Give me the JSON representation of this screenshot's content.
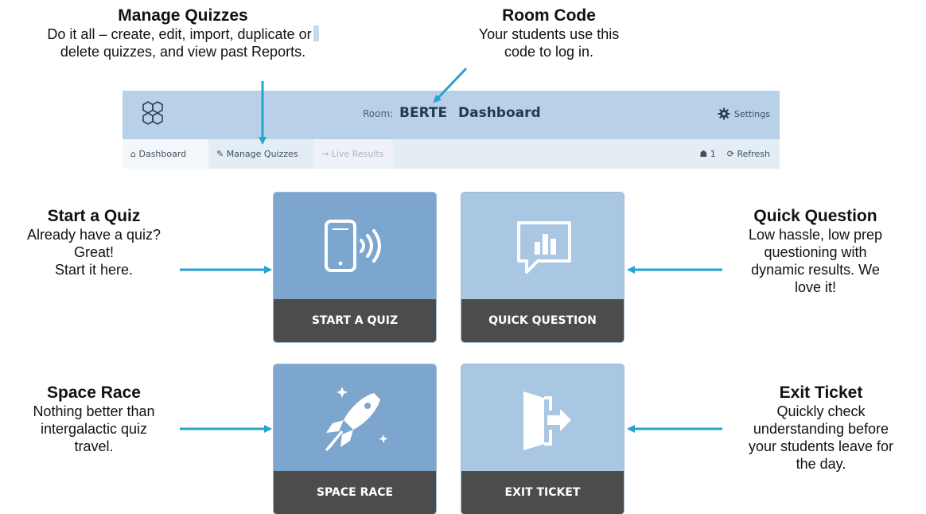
{
  "callouts": {
    "manage": {
      "title": "Manage Quizzes",
      "text": [
        "Do it all – create, edit, import, duplicate or",
        "delete quizzes, and view past Reports."
      ]
    },
    "room": {
      "title": "Room Code",
      "text": [
        "Your students use this",
        "code to log in."
      ]
    },
    "start": {
      "title": "Start a Quiz",
      "text": [
        "Already have a quiz?",
        "Great!",
        "Start it here."
      ]
    },
    "quick": {
      "title": "Quick Question",
      "text": [
        "Low hassle, low prep",
        "questioning with",
        "dynamic results. We",
        "love it!"
      ]
    },
    "space": {
      "title": "Space Race",
      "text": [
        "Nothing better than",
        "intergalactic quiz",
        "travel."
      ]
    },
    "exit": {
      "title": "Exit Ticket",
      "text": [
        "Quickly check",
        "understanding before",
        "your students leave for",
        "the day."
      ]
    }
  },
  "header": {
    "room_label": "Room:",
    "room_code": "BERTE",
    "title": "Dashboard",
    "settings": "Settings"
  },
  "nav": {
    "tabs": [
      "Dashboard",
      "Manage Quizzes",
      "Live Results"
    ],
    "student_count": "1",
    "refresh": "Refresh"
  },
  "tiles": {
    "start": "START A QUIZ",
    "quick": "QUICK QUESTION",
    "space": "SPACE RACE",
    "exit": "EXIT TICKET"
  },
  "colors": {
    "topbar": "#b9d1e8",
    "tile_dark": "#7da6cf",
    "tile_light": "#a9c6e3",
    "tile_bar": "#4c4c4c",
    "arrow": "#27a3cf"
  }
}
